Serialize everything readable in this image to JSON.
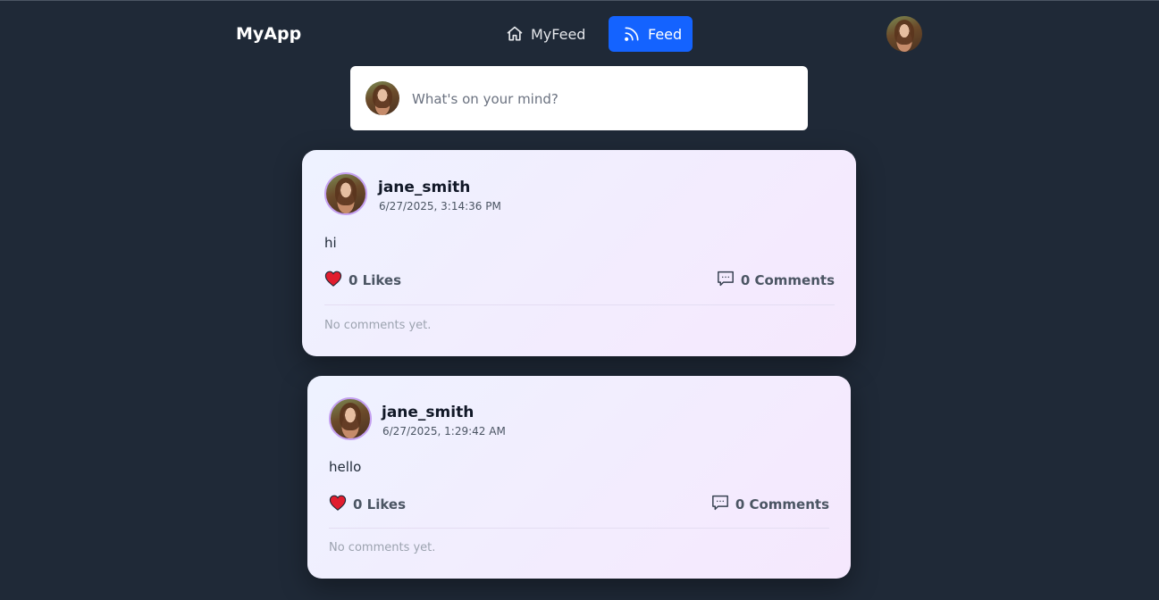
{
  "app": {
    "brand": "MyApp"
  },
  "nav": {
    "items": [
      {
        "label": "MyFeed",
        "icon": "home-icon",
        "active": false
      },
      {
        "label": "Feed",
        "icon": "rss-icon",
        "active": true
      }
    ]
  },
  "composer": {
    "placeholder": "What's on your mind?"
  },
  "posts": [
    {
      "username": "jane_smith",
      "timestamp": "6/27/2025, 3:14:36 PM",
      "content": "hi",
      "likes": "0 Likes",
      "comments": "0 Comments",
      "no_comments_text": "No comments yet."
    },
    {
      "username": "jane_smith",
      "timestamp": "6/27/2025, 1:29:42 AM",
      "content": "hello",
      "likes": "0 Likes",
      "comments": "0 Comments",
      "no_comments_text": "No comments yet."
    }
  ],
  "colors": {
    "background": "#1f2937",
    "accent": "#1463ff",
    "heart": "#e11d2e"
  }
}
